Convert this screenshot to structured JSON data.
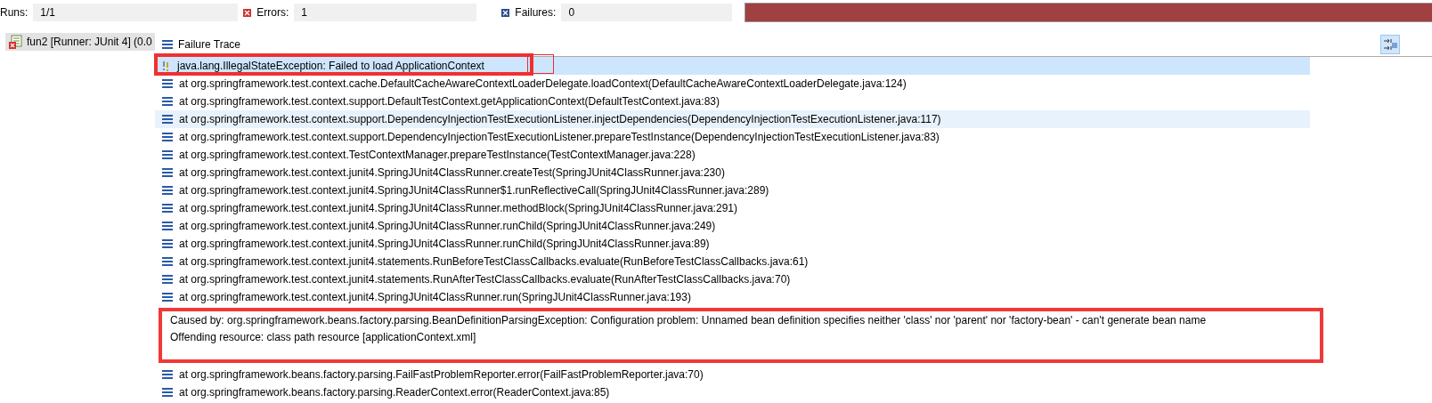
{
  "status": {
    "runs": {
      "label": "Runs:",
      "value": "1/1"
    },
    "errors": {
      "label": "Errors:",
      "value": "1"
    },
    "failures": {
      "label": "Failures:",
      "value": "0"
    },
    "progress": {
      "level": 1,
      "failed": true
    }
  },
  "tree": [
    {
      "label": "fun2 [Runner: JUnit 4] (0.0",
      "selected": true,
      "failed": true
    }
  ],
  "trace": {
    "title": "Failure Trace",
    "lines": [
      {
        "kind": "exception",
        "text": "java.lang.IllegalStateException: Failed to load ApplicationContext",
        "selected": true,
        "hovered": false,
        "annotated": true
      },
      {
        "kind": "frame",
        "text": "at org.springframework.test.context.cache.DefaultCacheAwareContextLoaderDelegate.loadContext(DefaultCacheAwareContextLoaderDelegate.java:124)",
        "selected": false,
        "hovered": false
      },
      {
        "kind": "frame",
        "text": "at org.springframework.test.context.support.DefaultTestContext.getApplicationContext(DefaultTestContext.java:83)",
        "selected": false,
        "hovered": false
      },
      {
        "kind": "frame",
        "text": "at org.springframework.test.context.support.DependencyInjectionTestExecutionListener.injectDependencies(DependencyInjectionTestExecutionListener.java:117)",
        "selected": false,
        "hovered": true
      },
      {
        "kind": "frame",
        "text": "at org.springframework.test.context.support.DependencyInjectionTestExecutionListener.prepareTestInstance(DependencyInjectionTestExecutionListener.java:83)",
        "selected": false,
        "hovered": false
      },
      {
        "kind": "frame",
        "text": "at org.springframework.test.context.TestContextManager.prepareTestInstance(TestContextManager.java:228)",
        "selected": false,
        "hovered": false
      },
      {
        "kind": "frame",
        "text": "at org.springframework.test.context.junit4.SpringJUnit4ClassRunner.createTest(SpringJUnit4ClassRunner.java:230)",
        "selected": false,
        "hovered": false
      },
      {
        "kind": "frame",
        "text": "at org.springframework.test.context.junit4.SpringJUnit4ClassRunner$1.runReflectiveCall(SpringJUnit4ClassRunner.java:289)",
        "selected": false,
        "hovered": false
      },
      {
        "kind": "frame",
        "text": "at org.springframework.test.context.junit4.SpringJUnit4ClassRunner.methodBlock(SpringJUnit4ClassRunner.java:291)",
        "selected": false,
        "hovered": false
      },
      {
        "kind": "frame",
        "text": "at org.springframework.test.context.junit4.SpringJUnit4ClassRunner.runChild(SpringJUnit4ClassRunner.java:249)",
        "selected": false,
        "hovered": false
      },
      {
        "kind": "frame",
        "text": "at org.springframework.test.context.junit4.SpringJUnit4ClassRunner.runChild(SpringJUnit4ClassRunner.java:89)",
        "selected": false,
        "hovered": false
      },
      {
        "kind": "frame",
        "text": "at org.springframework.test.context.junit4.statements.RunBeforeTestClassCallbacks.evaluate(RunBeforeTestClassCallbacks.java:61)",
        "selected": false,
        "hovered": false
      },
      {
        "kind": "frame",
        "text": "at org.springframework.test.context.junit4.statements.RunAfterTestClassCallbacks.evaluate(RunAfterTestClassCallbacks.java:70)",
        "selected": false,
        "hovered": false
      },
      {
        "kind": "frame",
        "text": "at org.springframework.test.context.junit4.SpringJUnit4ClassRunner.run(SpringJUnit4ClassRunner.java:193)",
        "selected": false,
        "hovered": false
      },
      {
        "kind": "cause",
        "lines": [
          "Caused by: org.springframework.beans.factory.parsing.BeanDefinitionParsingException: Configuration problem: Unnamed bean definition specifies neither 'class' nor 'parent' nor 'factory-bean' - can't generate bean name",
          "Offending resource: class path resource [applicationContext.xml]"
        ],
        "annotated": true
      },
      {
        "kind": "frame",
        "text": "at org.springframework.beans.factory.parsing.FailFastProblemReporter.error(FailFastProblemReporter.java:70)",
        "selected": false,
        "hovered": false
      },
      {
        "kind": "frame",
        "text": "at org.springframework.beans.factory.parsing.ReaderContext.error(ReaderContext.java:85)",
        "selected": false,
        "hovered": false
      }
    ]
  }
}
